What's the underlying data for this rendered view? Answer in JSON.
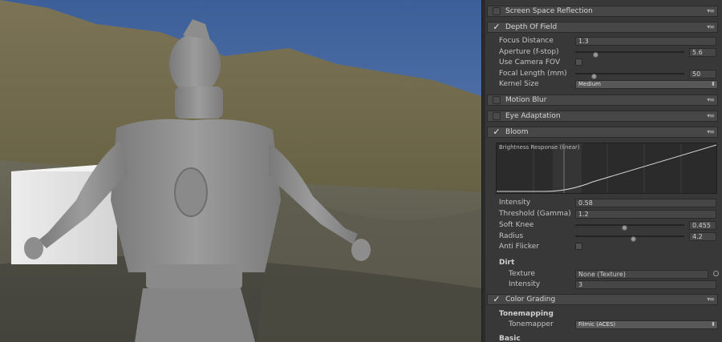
{
  "inspector": {
    "sections": {
      "ssr": {
        "title": "Screen Space Reflection",
        "enabled": false
      },
      "dof": {
        "title": "Depth Of Field",
        "enabled": true,
        "focus_distance": {
          "label": "Focus Distance",
          "value": "1.3"
        },
        "aperture": {
          "label": "Aperture (f-stop)",
          "value": "5.6",
          "fraction": 0.19
        },
        "use_camera_fov": {
          "label": "Use Camera FOV",
          "checked": false
        },
        "focal_length": {
          "label": "Focal Length (mm)",
          "value": "50",
          "fraction": 0.18
        },
        "kernel_size": {
          "label": "Kernel Size",
          "value": "Medium"
        }
      },
      "motion_blur": {
        "title": "Motion Blur",
        "enabled": false
      },
      "eye_adaptation": {
        "title": "Eye Adaptation",
        "enabled": false
      },
      "bloom": {
        "title": "Bloom",
        "enabled": true,
        "curve_title": "Brightness Response (linear)",
        "intensity": {
          "label": "Intensity",
          "value": "0.58"
        },
        "threshold": {
          "label": "Threshold (Gamma)",
          "value": "1.2"
        },
        "soft_knee": {
          "label": "Soft Knee",
          "value": "0.455",
          "fraction": 0.455
        },
        "radius": {
          "label": "Radius",
          "value": "4.2",
          "fraction": 0.54
        },
        "anti_flicker": {
          "label": "Anti Flicker",
          "checked": false
        },
        "dirt_heading": "Dirt",
        "texture": {
          "label": "Texture",
          "value": "None (Texture)"
        },
        "dirt_intensity": {
          "label": "Intensity",
          "value": "3"
        }
      },
      "color_grading": {
        "title": "Color Grading",
        "enabled": true,
        "tonemapping_heading": "Tonemapping",
        "tonemapper": {
          "label": "Tonemapper",
          "value": "Filmic (ACES)"
        },
        "basic_heading": "Basic"
      }
    },
    "icons": {
      "checkmark": "checkmark-icon",
      "menu": "section-menu-icon",
      "dropdown": "dropdown-arrow-icon"
    }
  }
}
